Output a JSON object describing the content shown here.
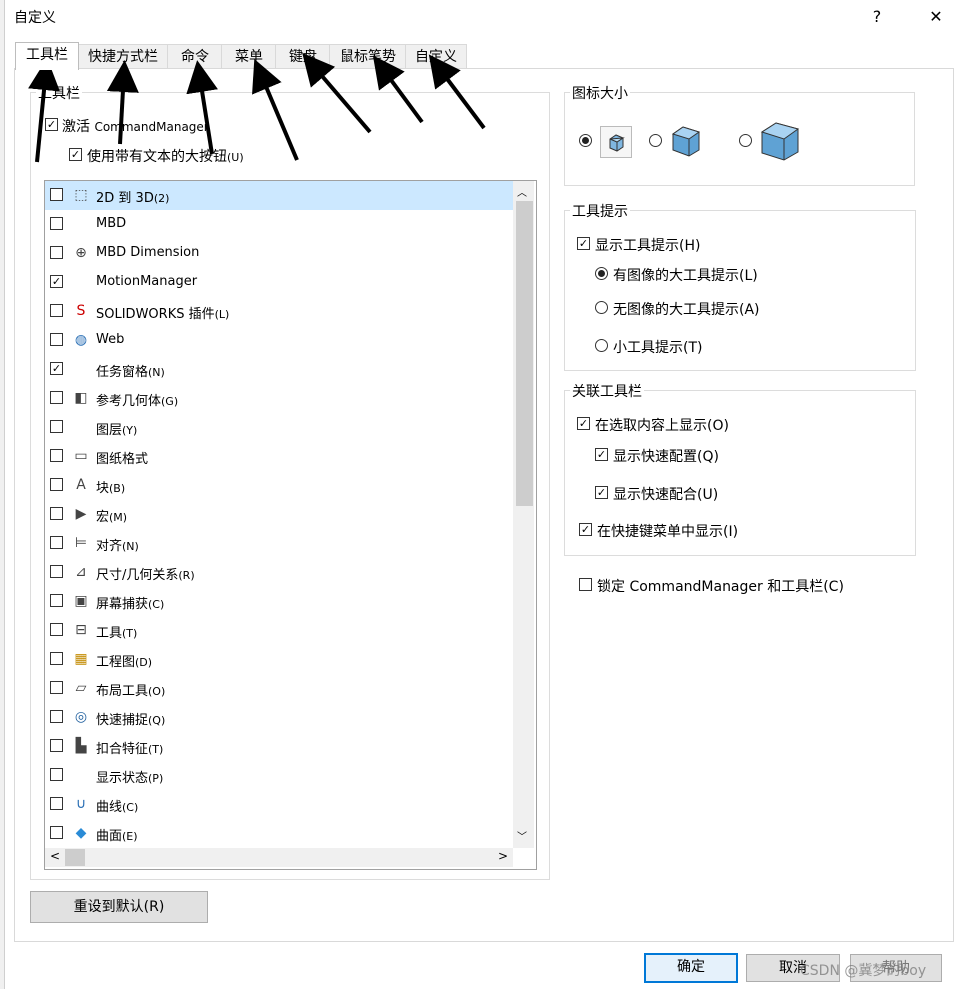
{
  "window": {
    "title": "自定义",
    "help": "?",
    "close": "✕"
  },
  "tabs": [
    "工具栏",
    "快捷方式栏",
    "命令",
    "菜单",
    "键盘",
    "鼠标笔势",
    "自定义"
  ],
  "toolbars": {
    "group_title": "工具栏",
    "activate_label": "激活",
    "activate_suffix": "CommandManager",
    "large_buttons_label": "使用带有文本的大按钮",
    "large_buttons_key": "(U)",
    "items": [
      {
        "name": "2D 到 3D",
        "key": "(2)",
        "checked": false,
        "icon": "2d-to-3d-icon"
      },
      {
        "name": "MBD",
        "key": "",
        "checked": false,
        "icon": ""
      },
      {
        "name": "MBD Dimension",
        "key": "",
        "checked": false,
        "icon": "crosshair-icon"
      },
      {
        "name": "MotionManager",
        "key": "",
        "checked": true,
        "icon": ""
      },
      {
        "name": "SOLIDWORKS 插件",
        "key": "(L)",
        "checked": false,
        "icon": "solidworks-addin-icon"
      },
      {
        "name": "Web",
        "key": "",
        "checked": false,
        "icon": "globe-icon"
      },
      {
        "name": "任务窗格",
        "key": "(N)",
        "checked": true,
        "icon": ""
      },
      {
        "name": "参考几何体",
        "key": "(G)",
        "checked": false,
        "icon": "reference-geometry-icon"
      },
      {
        "name": "图层",
        "key": "(Y)",
        "checked": false,
        "icon": ""
      },
      {
        "name": "图纸格式",
        "key": "",
        "checked": false,
        "icon": "sheet-format-icon"
      },
      {
        "name": "块",
        "key": "(B)",
        "checked": false,
        "icon": "block-icon"
      },
      {
        "name": "宏",
        "key": "(M)",
        "checked": false,
        "icon": "macro-icon"
      },
      {
        "name": "对齐",
        "key": "(N)",
        "checked": false,
        "icon": "align-icon"
      },
      {
        "name": "尺寸/几何关系",
        "key": "(R)",
        "checked": false,
        "icon": "dimension-icon"
      },
      {
        "name": "屏幕捕获",
        "key": "(C)",
        "checked": false,
        "icon": "screen-capture-icon"
      },
      {
        "name": "工具",
        "key": "(T)",
        "checked": false,
        "icon": "tools-icon"
      },
      {
        "name": "工程图",
        "key": "(D)",
        "checked": false,
        "icon": "drawing-icon"
      },
      {
        "name": "布局工具",
        "key": "(O)",
        "checked": false,
        "icon": "layout-icon"
      },
      {
        "name": "快速捕捉",
        "key": "(Q)",
        "checked": false,
        "icon": "quick-snap-icon"
      },
      {
        "name": "扣合特征",
        "key": "(T)",
        "checked": false,
        "icon": "fastening-icon"
      },
      {
        "name": "显示状态",
        "key": "(P)",
        "checked": false,
        "icon": ""
      },
      {
        "name": "曲线",
        "key": "(C)",
        "checked": false,
        "icon": "curve-icon"
      },
      {
        "name": "曲面",
        "key": "(E)",
        "checked": false,
        "icon": "surface-icon"
      }
    ],
    "reset_label": "重设到默认(R)"
  },
  "icon_size": {
    "title": "图标大小",
    "selected": 0
  },
  "tooltips": {
    "title": "工具提示",
    "show": "显示工具提示(H)",
    "large_with_image": "有图像的大工具提示(L)",
    "large_no_image": "无图像的大工具提示(A)",
    "small": "小工具提示(T)"
  },
  "context": {
    "title": "关联工具栏",
    "show_on_select": "在选取内容上显示(O)",
    "show_quick_config": "显示快速配置(Q)",
    "show_quick_mate": "显示快速配合(U)",
    "show_in_menu": "在快捷键菜单中显示(I)"
  },
  "lock_label": "锁定 CommandManager 和工具栏(C)",
  "footer": {
    "ok": "确定",
    "cancel": "取消",
    "help": "帮助",
    "watermark": "CSDN @冀梦的boy"
  },
  "colors": {
    "accent": "#0078d7",
    "selection": "#cce8ff"
  }
}
